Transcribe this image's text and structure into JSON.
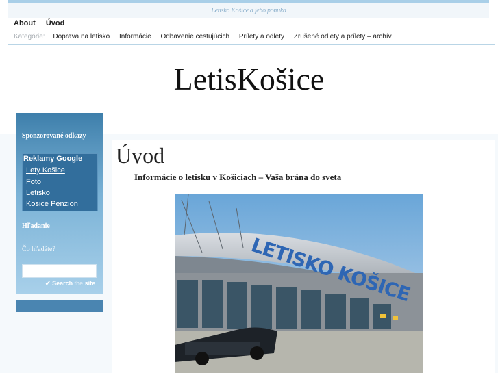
{
  "header": {
    "tagline": "Letisko Košice a jeho ponuka",
    "site_title": "LetisKošice"
  },
  "pages_nav": [
    {
      "label": "About"
    },
    {
      "label": "Úvod"
    }
  ],
  "categories": {
    "label": "Kategórie:",
    "items": [
      {
        "label": "Doprava na letisko"
      },
      {
        "label": "Informácie"
      },
      {
        "label": "Odbavenie cestujúcich"
      },
      {
        "label": "Prílety a odlety"
      },
      {
        "label": "Zrušené odlety a prílety – archív"
      }
    ]
  },
  "sidebar": {
    "sponsored_heading": "Sponzorované odkazy",
    "ads": {
      "title": "Reklamy Google",
      "links": [
        "Lety Košice",
        "Foto",
        "Letisko",
        "Kosice Penzion"
      ]
    },
    "search_heading": "Hľadanie",
    "search_label": "Čo hľadáte?",
    "search_value": "",
    "search_button": {
      "pre": "Search",
      "mid": "the",
      "post": "site"
    }
  },
  "main": {
    "heading": "Úvod",
    "intro": "Informácie o letisku v Košiciach – Vaša brána do sveta",
    "photo": {
      "sign_text": "LETISKO KOŠICE"
    }
  },
  "colors": {
    "sidebar_top": "#3e7fab",
    "sidebar_bottom": "#a8d0ea",
    "accent_line": "#b9d5e6"
  }
}
